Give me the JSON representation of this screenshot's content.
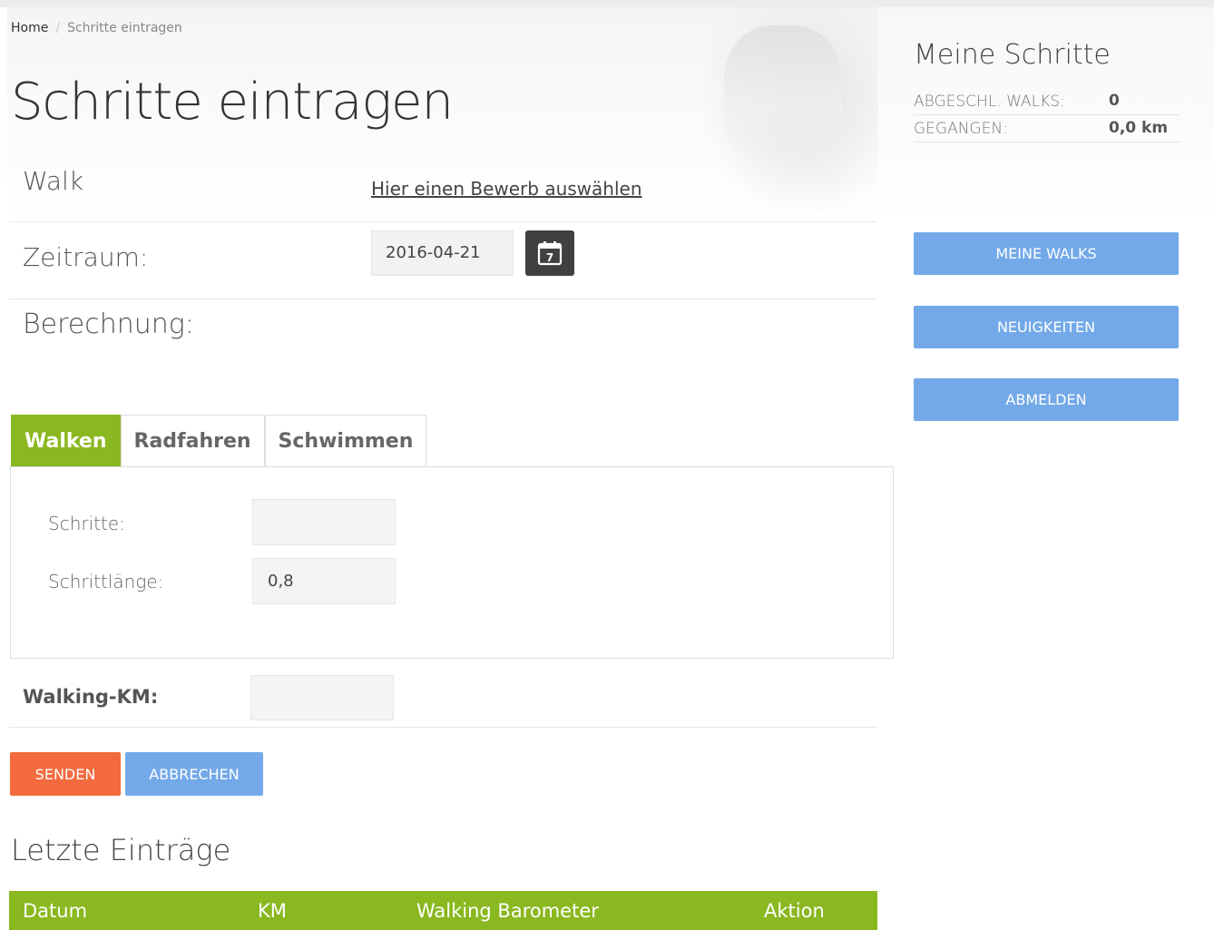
{
  "breadcrumb": {
    "home": "Home",
    "separator": "/",
    "current": "Schritte eintragen"
  },
  "page": {
    "title": "Schritte eintragen"
  },
  "form": {
    "walk_label": "Walk",
    "walk_link": "Hier einen Bewerb auswählen",
    "zeitraum_label": "Zeitraum:",
    "date_value": "2016-04-21",
    "calendar_icon_day": "7",
    "berechnung_label": "Berechnung:"
  },
  "tabs": [
    {
      "label": "Walken",
      "active": true
    },
    {
      "label": "Radfahren",
      "active": false
    },
    {
      "label": "Schwimmen",
      "active": false
    }
  ],
  "walken": {
    "schritte_label": "Schritte:",
    "schritte_value": "",
    "schrittlaenge_label": "Schrittlänge:",
    "schrittlaenge_value": "0,8"
  },
  "walking_km": {
    "label": "Walking-KM:",
    "value": ""
  },
  "actions": {
    "senden": "SENDEN",
    "abbrechen": "ABBRECHEN"
  },
  "recent": {
    "title": "Letzte Einträge",
    "columns": [
      "Datum",
      "KM",
      "Walking Barometer",
      "Aktion"
    ]
  },
  "sidebar": {
    "title": "Meine Schritte",
    "stats": [
      {
        "label": "ABGESCHL. WALKS:",
        "value": "0"
      },
      {
        "label": "GEGANGEN:",
        "value": "0,0 km"
      }
    ],
    "buttons": [
      "MEINE WALKS",
      "NEUIGKEITEN",
      "ABMELDEN"
    ]
  },
  "colors": {
    "accent_green": "#8ab820",
    "button_blue": "#73a9e8",
    "button_orange": "#f26a3e",
    "calendar_dark": "#3f4141"
  },
  "icons": {
    "calendar": "calendar-icon"
  }
}
